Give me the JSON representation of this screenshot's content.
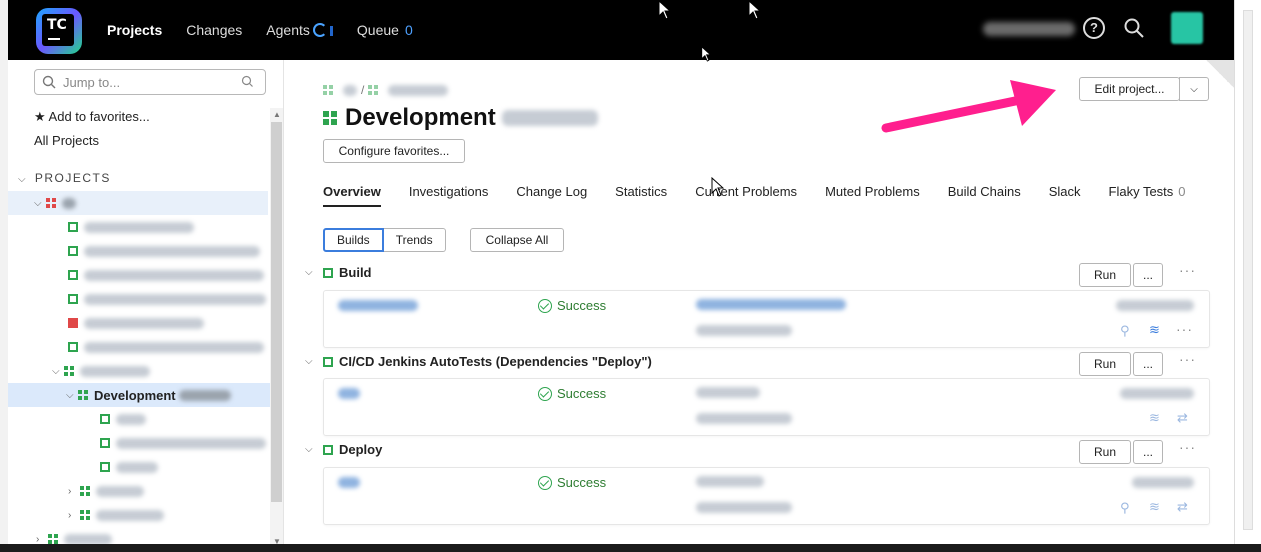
{
  "header": {
    "nav": [
      {
        "label": "Projects",
        "active": true
      },
      {
        "label": "Changes",
        "active": false
      },
      {
        "label": "Agents",
        "active": false
      },
      {
        "label": "Queue",
        "active": false
      }
    ],
    "queue_count": "0",
    "logo_text": "TC"
  },
  "sidebar": {
    "jump_placeholder": "Jump to...",
    "add_favorites": "★ Add to favorites...",
    "all_projects": "All Projects",
    "projects_header": "PROJECTS",
    "selected_project": "Development"
  },
  "main": {
    "title": "Development",
    "edit_project": "Edit project...",
    "configure_favorites": "Configure favorites...",
    "tabs": [
      {
        "label": "Overview",
        "active": true
      },
      {
        "label": "Investigations"
      },
      {
        "label": "Change Log"
      },
      {
        "label": "Statistics"
      },
      {
        "label": "Current Problems"
      },
      {
        "label": "Muted Problems"
      },
      {
        "label": "Build Chains"
      },
      {
        "label": "Slack"
      },
      {
        "label": "Flaky Tests"
      }
    ],
    "flaky_count": "0",
    "view_toggle": {
      "builds": "Builds",
      "trends": "Trends"
    },
    "collapse_all": "Collapse All",
    "sections": [
      {
        "name": "Build",
        "status": "Success",
        "run_label": "Run",
        "more_label": "..."
      },
      {
        "name": "CI/CD Jenkins AutoTests (Dependencies \"Deploy\")",
        "status": "Success",
        "run_label": "Run",
        "more_label": "..."
      },
      {
        "name": "Deploy",
        "status": "Success",
        "run_label": "Run",
        "more_label": "..."
      }
    ]
  },
  "colors": {
    "accent": "#3b7ddd",
    "success": "#2ea44f",
    "annotation_arrow": "#ff1f8e",
    "header_bg": "#000000"
  }
}
